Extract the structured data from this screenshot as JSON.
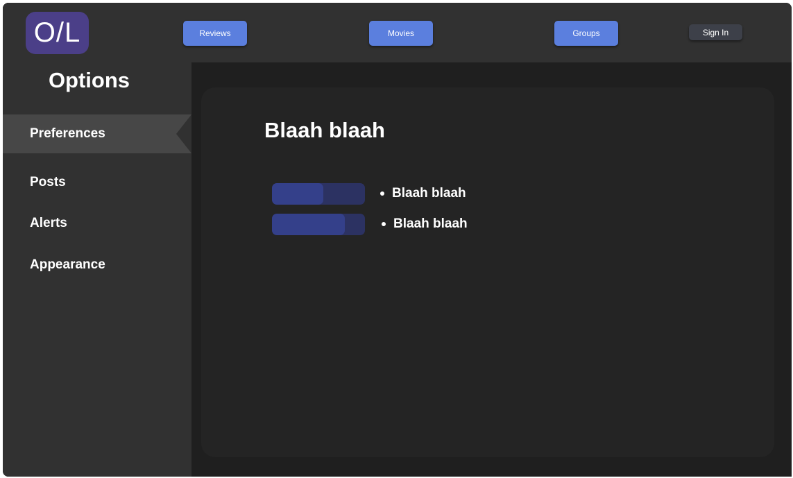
{
  "header": {
    "logo_text": "O/L",
    "nav": [
      {
        "label": "Reviews"
      },
      {
        "label": "Movies"
      },
      {
        "label": "Groups"
      }
    ],
    "sign_in_label": "Sign In"
  },
  "sidebar": {
    "title": "Options",
    "items": [
      {
        "label": "Preferences",
        "active": true
      },
      {
        "label": "Posts"
      },
      {
        "label": "Alerts"
      },
      {
        "label": "Appearance"
      }
    ]
  },
  "main": {
    "title": "Blaah blaah",
    "preferences": [
      {
        "label": "Blaah blaah",
        "level": 0.55
      },
      {
        "label": "Blaah blaah",
        "level": 0.78
      }
    ]
  },
  "colors": {
    "accent": "#5b7fde",
    "logo": "#4b3f88",
    "bar_track": "#2c3262",
    "bar_fill": "#34408a"
  }
}
